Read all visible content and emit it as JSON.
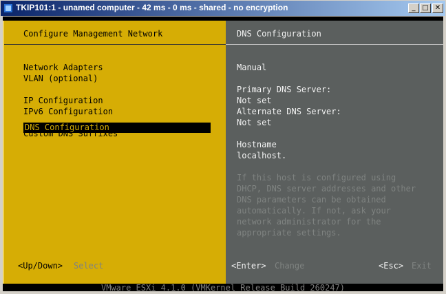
{
  "window": {
    "title": "TKIP101:1 - unamed computer - 42 ms - 0 ms - shared - no encryption",
    "minimize": "_",
    "maximize": "□",
    "close": "✕"
  },
  "left": {
    "header": "Configure Management Network",
    "menu": [
      "Network Adapters",
      "VLAN (optional)",
      "IP Configuration",
      "IPv6 Configuration",
      "DNS Configuration",
      "Custom DNS Suffixes"
    ],
    "selected_index": 4,
    "hint_key": "<Up/Down>",
    "hint_action": "Select"
  },
  "right": {
    "header": "DNS Configuration",
    "mode": "Manual",
    "primary_label": "Primary DNS Server:",
    "primary_value": "Not set",
    "alternate_label": "Alternate DNS Server:",
    "alternate_value": "Not set",
    "hostname_label": "Hostname",
    "hostname_value": "localhost.",
    "help_lines": [
      "If this host is configured using",
      "DHCP, DNS server addresses and other",
      "DNS parameters can be obtained",
      "automatically. If not, ask your",
      "network administrator for the",
      "appropriate settings."
    ],
    "enter_key": "<Enter>",
    "enter_action": "Change",
    "esc_key": "<Esc>",
    "esc_action": "Exit"
  },
  "footer": "VMware ESXi 4.1.0 (VMKernel Release Build 260247)",
  "colors": {
    "left_bg": "#d6ad05",
    "right_bg": "#5b5f5e",
    "selection_bg": "#000000"
  }
}
